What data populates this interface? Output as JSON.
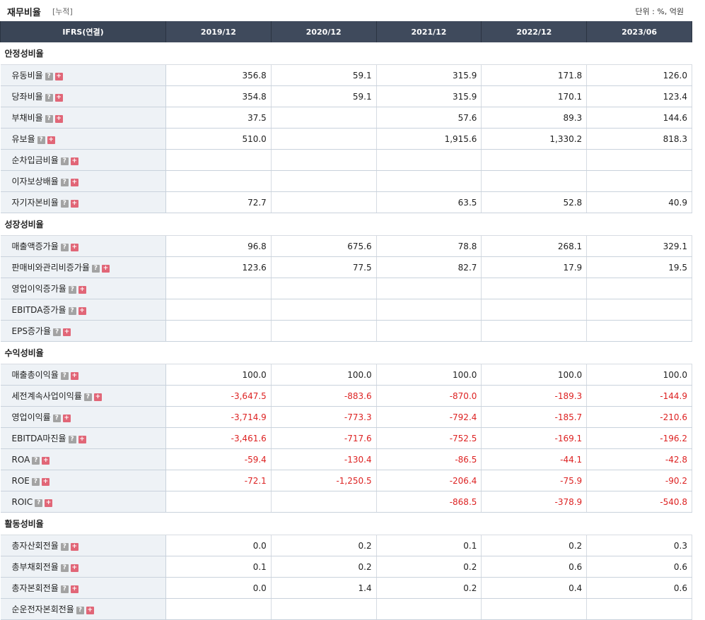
{
  "header": {
    "title": "재무비율",
    "subtitle": "[누적]",
    "unit": "단위 : %, 억원"
  },
  "table": {
    "columns": [
      "IFRS(연결)",
      "2019/12",
      "2020/12",
      "2021/12",
      "2022/12",
      "2023/06"
    ],
    "sections": [
      {
        "name": "안정성비율",
        "rows": [
          {
            "label": "유동비율",
            "values": [
              "356.8",
              "59.1",
              "315.9",
              "171.8",
              "126.0"
            ]
          },
          {
            "label": "당좌비율",
            "values": [
              "354.8",
              "59.1",
              "315.9",
              "170.1",
              "123.4"
            ]
          },
          {
            "label": "부채비율",
            "values": [
              "37.5",
              "",
              "57.6",
              "89.3",
              "144.6"
            ]
          },
          {
            "label": "유보율",
            "values": [
              "510.0",
              "",
              "1,915.6",
              "1,330.2",
              "818.3"
            ]
          },
          {
            "label": "순차입금비율",
            "values": [
              "",
              "",
              "",
              "",
              ""
            ]
          },
          {
            "label": "이자보상배율",
            "values": [
              "",
              "",
              "",
              "",
              ""
            ]
          },
          {
            "label": "자기자본비율",
            "values": [
              "72.7",
              "",
              "63.5",
              "52.8",
              "40.9"
            ]
          }
        ]
      },
      {
        "name": "성장성비율",
        "rows": [
          {
            "label": "매출액증가율",
            "values": [
              "96.8",
              "675.6",
              "78.8",
              "268.1",
              "329.1"
            ]
          },
          {
            "label": "판매비와관리비증가율",
            "values": [
              "123.6",
              "77.5",
              "82.7",
              "17.9",
              "19.5"
            ]
          },
          {
            "label": "영업이익증가율",
            "values": [
              "",
              "",
              "",
              "",
              ""
            ]
          },
          {
            "label": "EBITDA증가율",
            "values": [
              "",
              "",
              "",
              "",
              ""
            ]
          },
          {
            "label": "EPS증가율",
            "values": [
              "",
              "",
              "",
              "",
              ""
            ]
          }
        ]
      },
      {
        "name": "수익성비율",
        "rows": [
          {
            "label": "매출총이익율",
            "values": [
              "100.0",
              "100.0",
              "100.0",
              "100.0",
              "100.0"
            ]
          },
          {
            "label": "세전계속사업이익률",
            "values": [
              "-3,647.5",
              "-883.6",
              "-870.0",
              "-189.3",
              "-144.9"
            ]
          },
          {
            "label": "영업이익률",
            "values": [
              "-3,714.9",
              "-773.3",
              "-792.4",
              "-185.7",
              "-210.6"
            ]
          },
          {
            "label": "EBITDA마진율",
            "values": [
              "-3,461.6",
              "-717.6",
              "-752.5",
              "-169.1",
              "-196.2"
            ]
          },
          {
            "label": "ROA",
            "values": [
              "-59.4",
              "-130.4",
              "-86.5",
              "-44.1",
              "-42.8"
            ]
          },
          {
            "label": "ROE",
            "values": [
              "-72.1",
              "-1,250.5",
              "-206.4",
              "-75.9",
              "-90.2"
            ]
          },
          {
            "label": "ROIC",
            "values": [
              "",
              "",
              "-868.5",
              "-378.9",
              "-540.8"
            ]
          }
        ]
      },
      {
        "name": "활동성비율",
        "rows": [
          {
            "label": "총자산회전율",
            "values": [
              "0.0",
              "0.2",
              "0.1",
              "0.2",
              "0.3"
            ]
          },
          {
            "label": "총부채회전율",
            "values": [
              "0.1",
              "0.2",
              "0.2",
              "0.6",
              "0.6"
            ]
          },
          {
            "label": "총자본회전율",
            "values": [
              "0.0",
              "1.4",
              "0.2",
              "0.4",
              "0.6"
            ]
          },
          {
            "label": "순운전자본회전율",
            "values": [
              "",
              "",
              "",
              "",
              ""
            ]
          }
        ]
      }
    ]
  },
  "icons": {
    "help": "?",
    "expand": "+"
  },
  "colors": {
    "header_bg": "#3f4a5c",
    "negative": "#dd2222",
    "label_bg": "#eef2f6",
    "expand_icon": "#e16677"
  }
}
